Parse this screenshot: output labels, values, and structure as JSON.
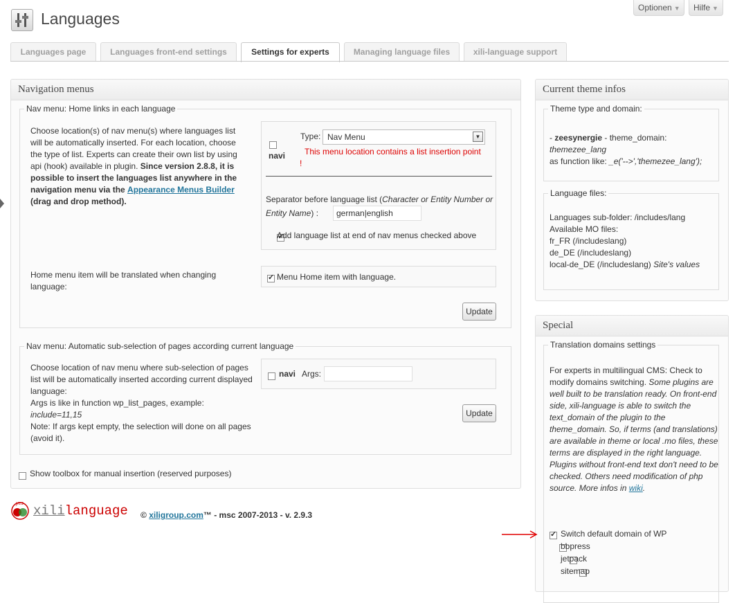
{
  "header": {
    "title": "Languages",
    "options_label": "Optionen",
    "help_label": "Hilfe"
  },
  "tabs": [
    {
      "label": "Languages page",
      "active": false
    },
    {
      "label": "Languages front-end settings",
      "active": false
    },
    {
      "label": "Settings for experts",
      "active": true
    },
    {
      "label": "Managing language files",
      "active": false
    },
    {
      "label": "xili-language support",
      "active": false
    }
  ],
  "nav_menus": {
    "title": "Navigation menus",
    "home_links": {
      "legend": "Nav menu: Home links in each language",
      "description": "Choose location(s) of nav menu(s) where languages list will be automatically inserted. For each location, choose the type of list. Experts can create their own list by using api (hook) available in plugin.",
      "bold_note_1": "Since version 2.8.8, it is possible to insert the languages list anywhere in the navigation menu via the",
      "link_label": "Appearance Menus Builder",
      "bold_note_2": "(drag and drop method).",
      "location_label": "navi",
      "type_label": "Type:",
      "type_value": "Nav Menu",
      "warning_text": "This menu location contains a list insertion point",
      "warning_mark": "!",
      "separator_text": "Separator before language list (",
      "separator_italic": "Character or Entity Number or Entity Name",
      "separator_end": ") :",
      "separator_value": "german|english",
      "add_list_label": "Add language list at end of nav menus checked above",
      "home_item_text": "Home menu item will be translated when changing language:",
      "home_item_checkbox": "Menu Home item with language.",
      "update_label": "Update"
    },
    "sub_selection": {
      "legend": "Nav menu: Automatic sub-selection of pages according current language",
      "line1": "Choose location of nav menu where sub-selection of pages list will be automatically inserted according current displayed language:",
      "line2": "Args is like in function wp_list_pages, example:",
      "example": "include=11,15",
      "line3": "Note: If args kept empty, the selection will done on all pages (avoid it).",
      "location_label": "navi",
      "args_label": "Args:",
      "args_value": "",
      "update_label": "Update"
    },
    "toolbox_label": "Show toolbox for manual insertion (reserved purposes)"
  },
  "footer": {
    "logo_prefix": "xili",
    "logo_suffix": "language",
    "logo_badge": "yes",
    "copyright_symbol": "©",
    "site_link": "xiligroup.com",
    "credit": "™ - msc 2007-2013 - v. 2.9.3"
  },
  "theme_infos": {
    "title": "Current theme infos",
    "type_domain": {
      "legend": "Theme type and domain:",
      "prefix": "- ",
      "theme_name": "zeesynergie",
      "domain_label": " - theme_domain: ",
      "domain_value": "themezee_lang",
      "function_label": "as function like: ",
      "function_value": "_e('-->','themezee_lang');"
    },
    "language_files": {
      "legend": "Language files:",
      "subfolder": "Languages sub-folder: /includes/lang",
      "available": "Available MO files:",
      "files": [
        "fr_FR (/includeslang)",
        "de_DE (/includeslang)",
        "local-de_DE (/includeslang)"
      ],
      "site_values": "Site's values"
    }
  },
  "special": {
    "title": "Special",
    "domains": {
      "legend": "Translation domains settings",
      "intro": "For experts in multilingual CMS: Check to modify domains switching.",
      "italic_text": "Some plugins are well built to be translation ready. On front-end side, xili-language is able to switch the text_domain of the plugin to the theme_domain. So, if terms (and translations) are available in theme or local .mo files, these terms are displayed in the right language. Plugins without front-end text don't need to be checked. Others need modification of php source.",
      "more_infos": "More infos in",
      "wiki_link": "wiki",
      "options": [
        {
          "label": "Switch default domain of WP",
          "checked": true
        },
        {
          "label": "bbpress",
          "checked": false
        },
        {
          "label": "jetpack",
          "checked": false
        },
        {
          "label": "sitemap",
          "checked": false
        }
      ]
    }
  },
  "colors": {
    "link": "#21759b",
    "warning": "#dd0000",
    "annotation_arrow": "#e00000"
  }
}
